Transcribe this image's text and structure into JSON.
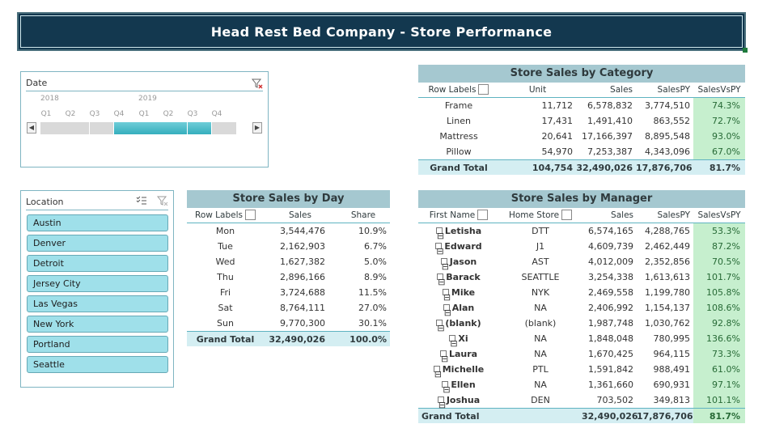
{
  "header": {
    "title": "Head Rest Bed Company - Store Performance"
  },
  "date_slicer": {
    "title": "Date",
    "years": [
      "2018",
      "2019"
    ],
    "quarters": [
      "Q1",
      "Q2",
      "Q3",
      "Q4",
      "Q1",
      "Q2",
      "Q3",
      "Q4"
    ],
    "selected_quarters": [
      3,
      4,
      5,
      6
    ],
    "left_arrow": "◀",
    "right_arrow": "▶"
  },
  "location_slicer": {
    "title": "Location",
    "items": [
      "Austin",
      "Denver",
      "Detroit",
      "Jersey City",
      "Las Vegas",
      "New York",
      "Portland",
      "Seattle"
    ]
  },
  "category_table": {
    "title": "Store Sales by Category",
    "headers": [
      "Row Labels",
      "Unit",
      "Sales",
      "SalesPY",
      "SalesVsPY"
    ],
    "rows": [
      [
        "Frame",
        "11,712",
        "6,578,832",
        "3,774,510",
        "74.3%"
      ],
      [
        "Linen",
        "17,431",
        "1,491,410",
        "863,552",
        "72.7%"
      ],
      [
        "Mattress",
        "20,641",
        "17,166,397",
        "8,895,548",
        "93.0%"
      ],
      [
        "Pillow",
        "54,970",
        "7,253,387",
        "4,343,096",
        "67.0%"
      ]
    ],
    "total": [
      "Grand Total",
      "104,754",
      "32,490,026",
      "17,876,706",
      "81.7%"
    ]
  },
  "day_table": {
    "title": "Store Sales by Day",
    "headers": [
      "Row Labels",
      "Sales",
      "Share"
    ],
    "rows": [
      [
        "Mon",
        "3,544,476",
        "10.9%"
      ],
      [
        "Tue",
        "2,162,903",
        "6.7%"
      ],
      [
        "Wed",
        "1,627,382",
        "5.0%"
      ],
      [
        "Thu",
        "2,896,166",
        "8.9%"
      ],
      [
        "Fri",
        "3,724,688",
        "11.5%"
      ],
      [
        "Sat",
        "8,764,111",
        "27.0%"
      ],
      [
        "Sun",
        "9,770,300",
        "30.1%"
      ]
    ],
    "total": [
      "Grand Total",
      "32,490,026",
      "100.0%"
    ]
  },
  "manager_table": {
    "title": "Store Sales by Manager",
    "headers": [
      "First Name",
      "Home Store",
      "Sales",
      "SalesPY",
      "SalesVsPY"
    ],
    "expand_symbol": "⊟",
    "rows": [
      [
        "Letisha",
        "DTT",
        "6,574,165",
        "4,288,765",
        "53.3%"
      ],
      [
        "Edward",
        "J1",
        "4,609,739",
        "2,462,449",
        "87.2%"
      ],
      [
        "Jason",
        "AST",
        "4,012,009",
        "2,352,856",
        "70.5%"
      ],
      [
        "Barack",
        "SEATTLE",
        "3,254,338",
        "1,613,613",
        "101.7%"
      ],
      [
        "Mike",
        "NYK",
        "2,469,558",
        "1,199,780",
        "105.8%"
      ],
      [
        "Alan",
        "NA",
        "2,406,992",
        "1,154,137",
        "108.6%"
      ],
      [
        "(blank)",
        "(blank)",
        "1,987,748",
        "1,030,762",
        "92.8%"
      ],
      [
        "Xi",
        "NA",
        "1,848,048",
        "780,995",
        "136.6%"
      ],
      [
        "Laura",
        "NA",
        "1,670,425",
        "964,115",
        "73.3%"
      ],
      [
        "Michelle",
        "PTL",
        "1,591,842",
        "988,491",
        "61.0%"
      ],
      [
        "Ellen",
        "NA",
        "1,361,660",
        "690,931",
        "97.1%"
      ],
      [
        "Joshua",
        "DEN",
        "703,502",
        "349,813",
        "101.1%"
      ]
    ],
    "total": [
      "Grand Total",
      "",
      "32,490,026",
      "17,876,706",
      "81.7%"
    ]
  },
  "colors": {
    "banner": "#13384f",
    "accent": "#5fb3c1",
    "positive": "#c6efce",
    "slicer_item": "#9fe0ea"
  }
}
